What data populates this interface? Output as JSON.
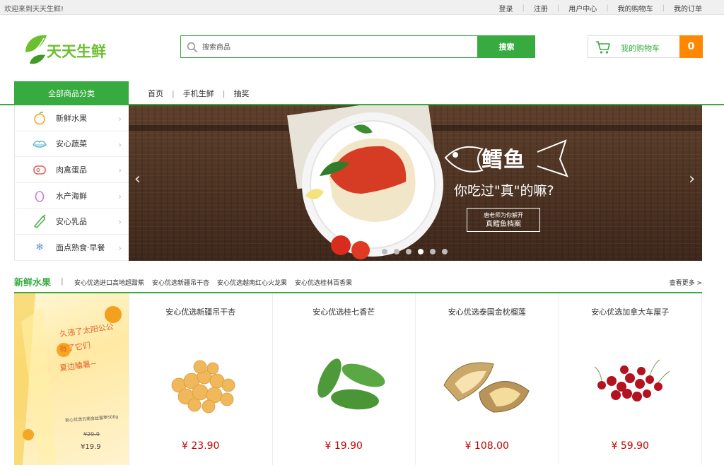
{
  "topbar": {
    "welcome": "欢迎来到天天生鲜!",
    "links": [
      "登录",
      "注册",
      "用户中心",
      "我的购物车",
      "我的订单"
    ]
  },
  "logo": {
    "text": "天天生鲜"
  },
  "search": {
    "placeholder": "搜索商品",
    "button": "搜索"
  },
  "cart": {
    "label": "我的购物车",
    "count": "0"
  },
  "nav": {
    "all_categories": "全部商品分类",
    "links": [
      "首页",
      "手机生鲜",
      "抽奖"
    ]
  },
  "sidebar": {
    "items": [
      {
        "label": "新鲜水果",
        "icon": "orange-icon"
      },
      {
        "label": "安心蔬菜",
        "icon": "vegetable-icon"
      },
      {
        "label": "肉禽蛋品",
        "icon": "meat-icon"
      },
      {
        "label": "水产海鲜",
        "icon": "seafood-icon"
      },
      {
        "label": "安心乳品",
        "icon": "milk-icon"
      },
      {
        "label": "面点熟食·早餐",
        "icon": "snowflake-icon"
      }
    ]
  },
  "banner": {
    "fish_name": "鳕鱼",
    "headline": "你吃过\"真\"的嘛?",
    "tag_line1": "唐老师为你解开",
    "tag_line2": "真鳕鱼档案",
    "slide_count": 6,
    "active_slide": 4
  },
  "section": {
    "title": "新鲜水果",
    "divider": "|",
    "sub_links": [
      "安心优选进口高地超甜蕉",
      "安心优选新疆吊干杏",
      "安心优选越南红心火龙果",
      "安心优选桂林百香果"
    ],
    "more": "查看更多 >"
  },
  "promo": {
    "line1": "久违了太阳公公",
    "line2": "有了它们",
    "line3": "夏边瞌暑~",
    "product": "安心优选云南金丝蜜枣500g",
    "old_price": "¥29.9",
    "new_price": "¥19.9"
  },
  "products": [
    {
      "name": "安心优选新疆吊干杏",
      "price": "¥ 23.90",
      "image": "apricot"
    },
    {
      "name": "安心优选桂七香芒",
      "price": "¥ 19.90",
      "image": "mango"
    },
    {
      "name": "安心优选泰国金枕榴莲",
      "price": "¥ 108.00",
      "image": "durian"
    },
    {
      "name": "安心优选加拿大车厘子",
      "price": "¥ 59.90",
      "image": "cherry"
    }
  ],
  "colors": {
    "brand": "#37ab40",
    "accent": "#ff8800",
    "price": "#c40000"
  }
}
